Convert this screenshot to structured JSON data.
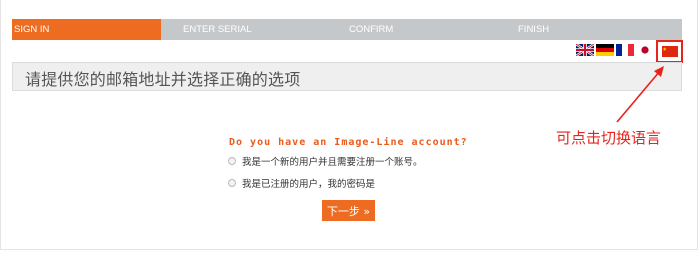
{
  "steps": [
    {
      "label": "SIGN IN",
      "active": true
    },
    {
      "label": "ENTER SERIAL",
      "active": false
    },
    {
      "label": "CONFIRM",
      "active": false
    },
    {
      "label": "FINISH",
      "active": false
    }
  ],
  "languages": {
    "items": [
      "uk-flag-icon",
      "germany-flag-icon",
      "france-flag-icon",
      "japan-flag-icon",
      "china-flag-icon"
    ],
    "selected": "china-flag-icon"
  },
  "prompt": "请提供您的邮箱地址并选择正确的选项",
  "form": {
    "question": "Do you have an Image-Line account?",
    "options": [
      "我是一个新的用户并且需要注册一个账号。",
      "我是已注册的用户，我的密码是"
    ],
    "next_label": "下一步 »"
  },
  "annotation": {
    "text": "可点击切换语言",
    "color": "#e8231c"
  },
  "colors": {
    "accent": "#ee6b22",
    "step_bar": "#c4c8cb",
    "question": "#ea5b1c"
  }
}
